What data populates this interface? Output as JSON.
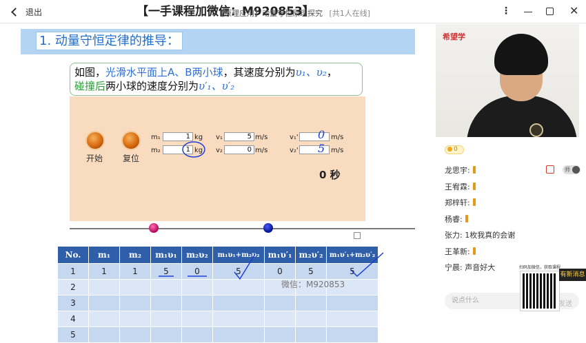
{
  "topbar": {
    "back_label": "退出",
    "watermark": "【一手课程加微信：M920853】",
    "course_title": "【原理应用】动量守恒原理探究",
    "online": "[共1人在线]",
    "more_icon": "more-vertical-icon",
    "minimize_icon": "minimize-icon",
    "maximize_icon": "maximize-icon",
    "close_icon": "close-icon"
  },
  "slide": {
    "heading": "1. 动量守恒定律的推导：",
    "desc_part1": "如图，",
    "desc_part2": "光滑水平面上A、B两小球",
    "desc_part3": "，其速度分别为",
    "desc_v": "υ₁、υ₂",
    "desc_part4": "，",
    "desc_part5": "碰撞后",
    "desc_part6": "两小球的速度分别为",
    "desc_v2": "υ′₁、υ′₂",
    "controls": {
      "start": "开始",
      "reset": "复位"
    },
    "inputs": {
      "m1_label": "m₁",
      "m1_value": "1",
      "m1_unit": "kg",
      "m2_label": "m₂",
      "m2_value": "1",
      "m2_unit": "kg",
      "v1_label": "v₁",
      "v1_value": "5",
      "v1_unit": "m/s",
      "v2_label": "v₂",
      "v2_value": "0",
      "v2_unit": "m/s",
      "v1p_label": "v₁'",
      "v1p_value": "0",
      "v1p_unit": "m/s",
      "v2p_label": "v₂'",
      "v2p_value": "5",
      "v2p_unit": "m/s"
    },
    "timer": "0 秒",
    "table": {
      "headers": [
        "No.",
        "m₁",
        "m₂",
        "m₁υ₁",
        "m₂υ₂",
        "m₁υ₁+m₂υ₂",
        "m₁υ′₁",
        "m₂υ′₂",
        "m₁υ′₁+m₂υ′₂"
      ],
      "rows": [
        [
          "1",
          "1",
          "1",
          "5",
          "0",
          "5",
          "0",
          "5",
          "5"
        ],
        [
          "2",
          "",
          "",
          "",
          "",
          "",
          "",
          "",
          ""
        ],
        [
          "3",
          "",
          "",
          "",
          "",
          "",
          "",
          "",
          ""
        ],
        [
          "4",
          "",
          "",
          "",
          "",
          "",
          "",
          "",
          ""
        ],
        [
          "5",
          "",
          "",
          "",
          "",
          "",
          "",
          "",
          ""
        ]
      ]
    },
    "watermark_mid": "微信：M920853"
  },
  "sidebar": {
    "brand": "希望学",
    "coins": "0",
    "toggle_label": "师",
    "chat": [
      {
        "name": "龙思宇:",
        "text": "",
        "candle": true
      },
      {
        "name": "王宥霖:",
        "text": "",
        "candle": true
      },
      {
        "name": "郑梓轩:",
        "text": "",
        "candle": true
      },
      {
        "name": "杨睿:",
        "text": "",
        "candle": true
      },
      {
        "name": "张力:",
        "text": "1枚我真的会谢",
        "candle": false
      },
      {
        "name": "王革新:",
        "text": "",
        "candle": true
      },
      {
        "name": "宁晨:",
        "text": "声音好大",
        "candle": false
      }
    ],
    "input_placeholder": "说点什么",
    "send": "发送",
    "qr_caption": "扫码加微信，获取课程",
    "new_message": "有新消息"
  },
  "colors": {
    "heading_bar": "#b3d4f2",
    "heading_text": "#1f6fcc",
    "sim_bg": "#f9dcbf",
    "table_header": "#2e5fa8",
    "ink": "#1b3fd8"
  }
}
